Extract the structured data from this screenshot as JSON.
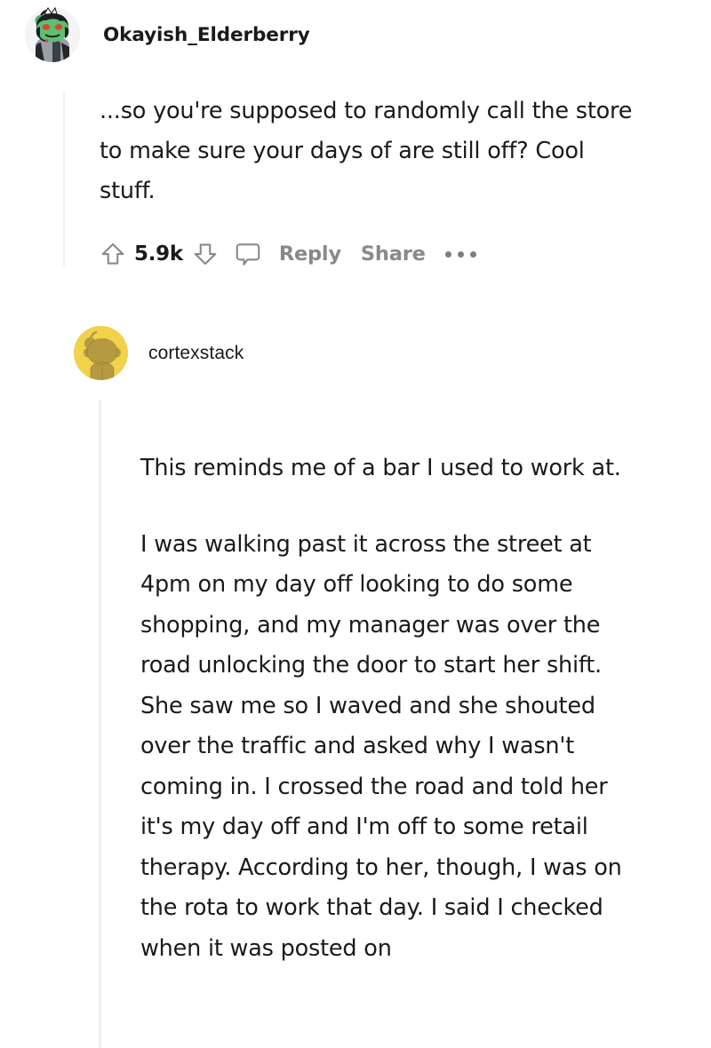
{
  "comments": [
    {
      "username": "Okayish_Elderberry",
      "avatar": "snoo-avatar-dark-green",
      "body": "...so you're supposed to randomly call the store to make sure your days of are still off? Cool stuff.",
      "actions": {
        "upvote_icon": "upvote-arrow-icon",
        "score": "5.9k",
        "downvote_icon": "downvote-arrow-icon",
        "comment_icon": "comment-bubble-icon",
        "reply_label": "Reply",
        "share_label": "Share",
        "more_icon": "more-options-icon"
      }
    },
    {
      "username": "cortexstack",
      "avatar": "snoo-avatar-yellow",
      "meta": "",
      "paragraphs": [
        "This reminds me of a bar I used to work at.",
        "I was walking past it across the street at 4pm on my day off looking to do some shopping, and my manager was over the road unlocking the door to start her shift. She saw me so I waved and she shouted over the traffic and asked why I wasn't coming in. I crossed the road and told her it's my day off and I'm off to some retail therapy. According to her, though, I was on the rota to work that day. I said I checked when it was posted on"
      ]
    }
  ],
  "theme": {
    "background": "#ffffff",
    "text": "#1a1a1b",
    "muted": "#878a8c",
    "threadline": "#edeff1",
    "avatar_yellow": "#f0d24b"
  }
}
